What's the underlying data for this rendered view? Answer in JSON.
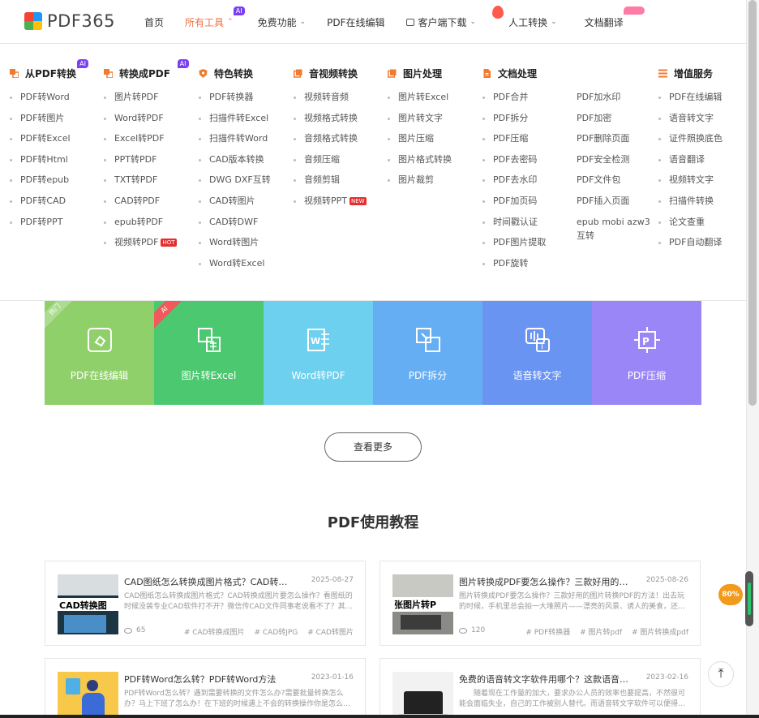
{
  "logo": {
    "text": "PDF365"
  },
  "nav": {
    "home": "首页",
    "all_tools": "所有工具",
    "ai_badge": "AI",
    "free": "免费功能",
    "online_edit": "PDF在线编辑",
    "client_download": "客户端下载",
    "human_convert": "人工转换",
    "doc_translate": "文档翻译"
  },
  "menu": {
    "from_pdf": {
      "title": "从PDF转换",
      "badge": "AI",
      "items": [
        "PDF转Word",
        "PDF转图片",
        "PDF转Excel",
        "PDF转Html",
        "PDF转epub",
        "PDF转CAD",
        "PDF转PPT"
      ]
    },
    "to_pdf": {
      "title": "转换成PDF",
      "badge": "AI",
      "items": [
        "图片转PDF",
        "Word转PDF",
        "Excel转PDF",
        "PPT转PDF",
        "TXT转PDF",
        "CAD转PDF",
        "epub转PDF",
        "视频转PDF"
      ],
      "hot_tag": "HOT"
    },
    "special": {
      "title": "特色转换",
      "items": [
        "PDF转换器",
        "扫描件转Excel",
        "扫描件转Word",
        "CAD版本转换",
        "DWG DXF互转",
        "CAD转图片",
        "CAD转DWF",
        "Word转图片",
        "Word转Excel"
      ]
    },
    "av": {
      "title": "音视频转换",
      "items": [
        "视频转音频",
        "视频格式转换",
        "音频格式转换",
        "音频压缩",
        "音频剪辑",
        "视频转PPT"
      ],
      "new_tag": "NEW"
    },
    "image": {
      "title": "图片处理",
      "items": [
        "图片转Excel",
        "图片转文字",
        "图片压缩",
        "图片格式转换",
        "图片裁剪"
      ]
    },
    "doc": {
      "title": "文档处理",
      "items": [
        "PDF合并",
        "PDF拆分",
        "PDF压缩",
        "PDF去密码",
        "PDF去水印",
        "PDF加页码",
        "时间戳认证",
        "PDF图片提取",
        "PDF旋转"
      ],
      "items2": [
        "PDF加水印",
        "PDF加密",
        "PDF删除页面",
        "PDF安全检测",
        "PDF文件包",
        "PDF插入页面",
        "epub mobi azw3",
        "互转"
      ]
    },
    "value": {
      "title": "增值服务",
      "items": [
        "PDF在线编辑",
        "语音转文字",
        "证件照换底色",
        "语音翻译",
        "视频转文字",
        "扫描件转换",
        "论文查重",
        "PDF自动翻译"
      ]
    }
  },
  "tiles": [
    {
      "label": "PDF在线编辑",
      "color": "#8fd06a",
      "ribbon": "热门",
      "icon": "edit-icon"
    },
    {
      "label": "图片转Excel",
      "color": "#4cc870",
      "ribbon": "AI",
      "icon": "image-excel-icon"
    },
    {
      "label": "Word转PDF",
      "color": "#6dd0ef",
      "icon": "word-icon"
    },
    {
      "label": "PDF拆分",
      "color": "#66aef4",
      "icon": "split-icon"
    },
    {
      "label": "语音转文字",
      "color": "#6a94f2",
      "icon": "speech-text-icon"
    },
    {
      "label": "PDF压缩",
      "color": "#9a86f6",
      "icon": "compress-icon"
    }
  ],
  "more_button": "查看更多",
  "section_title": "PDF使用教程",
  "articles": [
    {
      "title": "CAD图纸怎么转换成图片格式？CAD转换成图片要怎么操作？",
      "date": "2025-08-27",
      "desc": "CAD图纸怎么转换成图片格式？CAD转换成图片要怎么操作？看图纸的时候没装专业CAD软件打不开？微信传CAD文件同事老说看不了？其…",
      "views": "65",
      "tags": [
        "# CAD转换成图片",
        "# CAD转JPG",
        "# CAD转图片"
      ],
      "thumb_text": "CAD转换图"
    },
    {
      "title": "图片转换成PDF要怎么操作？三款好用的图片转换PDF的方法",
      "date": "2025-08-26",
      "desc": "图片转换成PDF要怎么操作？三款好用的图片转换PDF的方法！出去玩的时候，手机里总会拍一大堆照片——漂亮的风景、诱人的美食，还…",
      "views": "120",
      "tags": [
        "# PDF转换器",
        "# 图片转pdf",
        "# 图片转换成pdf"
      ],
      "thumb_text": "张图片转P"
    },
    {
      "title": "PDF转Word怎么转？PDF转Word方法",
      "date": "2023-01-16",
      "desc": "PDF转Word怎么转？遇到需要转换的文件怎么办?需要批量转换怎么办？马上下班了怎么办！在下班的时候遇上不会的转换操作你是怎么…",
      "views": "",
      "tags": [],
      "thumb_text": ""
    },
    {
      "title": "免费的语音转文字软件用哪个？这款语音转文字工具好用",
      "date": "2023-02-16",
      "desc": "随着现在工作量的加大，要求办公人员的效率也要提高，不然很可能会面临失业，自己的工作被别人替代。而语音转文字软件可以便得…",
      "views": "",
      "tags": [],
      "thumb_text": ""
    }
  ],
  "float_widget": {
    "percent": "80%"
  },
  "colors": {
    "accent": "#f07040",
    "ai_purple": "#7b3ff2",
    "hot_red": "#e62e2e"
  }
}
